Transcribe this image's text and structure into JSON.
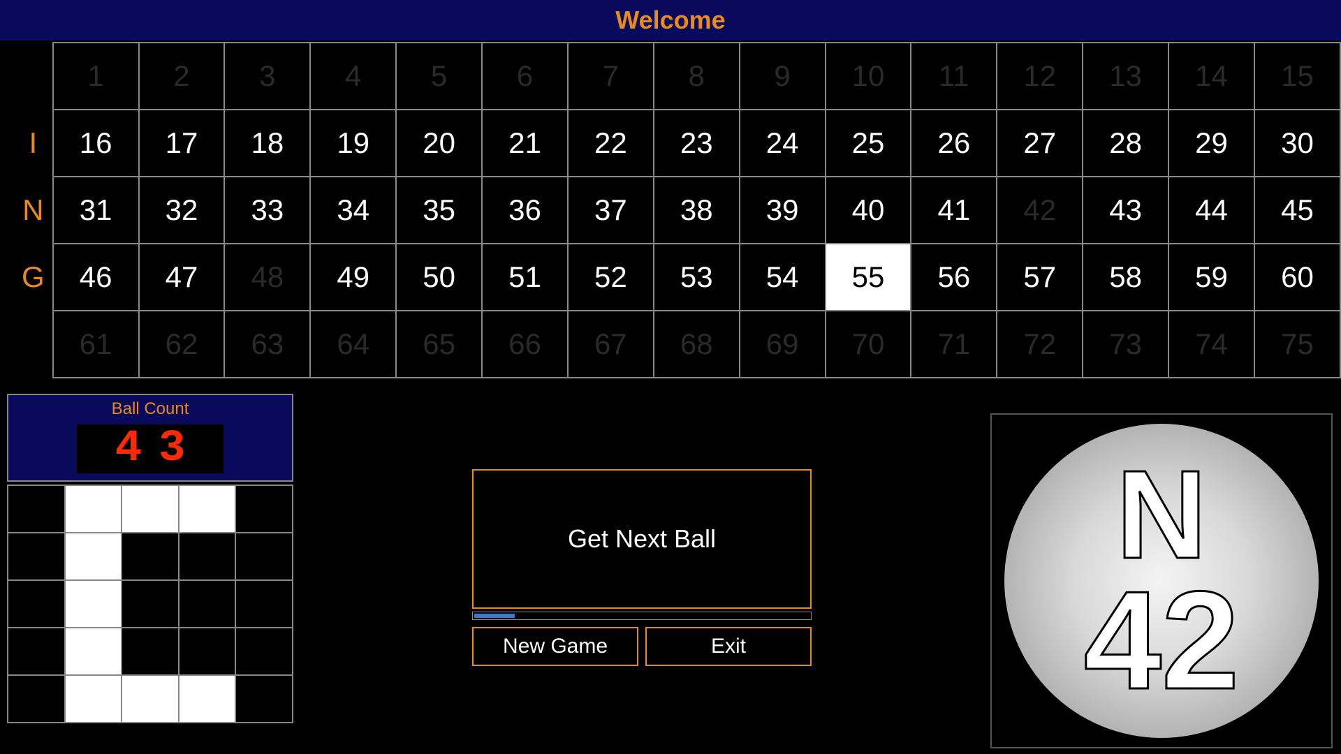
{
  "header": {
    "title": "Welcome"
  },
  "row_labels": [
    "",
    "I",
    "N",
    "G",
    ""
  ],
  "board": {
    "rows": [
      [
        {
          "n": 1,
          "s": "dim"
        },
        {
          "n": 2,
          "s": "dim"
        },
        {
          "n": 3,
          "s": "dim"
        },
        {
          "n": 4,
          "s": "dim"
        },
        {
          "n": 5,
          "s": "dim"
        },
        {
          "n": 6,
          "s": "dim"
        },
        {
          "n": 7,
          "s": "dim"
        },
        {
          "n": 8,
          "s": "dim"
        },
        {
          "n": 9,
          "s": "dim"
        },
        {
          "n": 10,
          "s": "dim"
        },
        {
          "n": 11,
          "s": "dim"
        },
        {
          "n": 12,
          "s": "dim"
        },
        {
          "n": 13,
          "s": "dim"
        },
        {
          "n": 14,
          "s": "dim"
        },
        {
          "n": 15,
          "s": "dim"
        }
      ],
      [
        {
          "n": 16,
          "s": "on"
        },
        {
          "n": 17,
          "s": "on"
        },
        {
          "n": 18,
          "s": "on"
        },
        {
          "n": 19,
          "s": "on"
        },
        {
          "n": 20,
          "s": "on"
        },
        {
          "n": 21,
          "s": "on"
        },
        {
          "n": 22,
          "s": "on"
        },
        {
          "n": 23,
          "s": "on"
        },
        {
          "n": 24,
          "s": "on"
        },
        {
          "n": 25,
          "s": "on"
        },
        {
          "n": 26,
          "s": "on"
        },
        {
          "n": 27,
          "s": "on"
        },
        {
          "n": 28,
          "s": "on"
        },
        {
          "n": 29,
          "s": "on"
        },
        {
          "n": 30,
          "s": "on"
        }
      ],
      [
        {
          "n": 31,
          "s": "on"
        },
        {
          "n": 32,
          "s": "on"
        },
        {
          "n": 33,
          "s": "on"
        },
        {
          "n": 34,
          "s": "on"
        },
        {
          "n": 35,
          "s": "on"
        },
        {
          "n": 36,
          "s": "on"
        },
        {
          "n": 37,
          "s": "on"
        },
        {
          "n": 38,
          "s": "on"
        },
        {
          "n": 39,
          "s": "on"
        },
        {
          "n": 40,
          "s": "on"
        },
        {
          "n": 41,
          "s": "on"
        },
        {
          "n": 42,
          "s": "dim"
        },
        {
          "n": 43,
          "s": "on"
        },
        {
          "n": 44,
          "s": "on"
        },
        {
          "n": 45,
          "s": "on"
        }
      ],
      [
        {
          "n": 46,
          "s": "on"
        },
        {
          "n": 47,
          "s": "on"
        },
        {
          "n": 48,
          "s": "dim"
        },
        {
          "n": 49,
          "s": "on"
        },
        {
          "n": 50,
          "s": "on"
        },
        {
          "n": 51,
          "s": "on"
        },
        {
          "n": 52,
          "s": "on"
        },
        {
          "n": 53,
          "s": "on"
        },
        {
          "n": 54,
          "s": "on"
        },
        {
          "n": 55,
          "s": "last"
        },
        {
          "n": 56,
          "s": "on"
        },
        {
          "n": 57,
          "s": "on"
        },
        {
          "n": 58,
          "s": "on"
        },
        {
          "n": 59,
          "s": "on"
        },
        {
          "n": 60,
          "s": "on"
        }
      ],
      [
        {
          "n": 61,
          "s": "dim"
        },
        {
          "n": 62,
          "s": "dim"
        },
        {
          "n": 63,
          "s": "dim"
        },
        {
          "n": 64,
          "s": "dim"
        },
        {
          "n": 65,
          "s": "dim"
        },
        {
          "n": 66,
          "s": "dim"
        },
        {
          "n": 67,
          "s": "dim"
        },
        {
          "n": 68,
          "s": "dim"
        },
        {
          "n": 69,
          "s": "dim"
        },
        {
          "n": 70,
          "s": "dim"
        },
        {
          "n": 71,
          "s": "dim"
        },
        {
          "n": 72,
          "s": "dim"
        },
        {
          "n": 73,
          "s": "dim"
        },
        {
          "n": 74,
          "s": "dim"
        },
        {
          "n": 75,
          "s": "dim"
        }
      ]
    ]
  },
  "ball_count": {
    "label": "Ball Count",
    "value": "43"
  },
  "pattern": [
    [
      0,
      1,
      1,
      1,
      0
    ],
    [
      0,
      1,
      0,
      0,
      0
    ],
    [
      0,
      1,
      0,
      0,
      0
    ],
    [
      0,
      1,
      0,
      0,
      0
    ],
    [
      0,
      1,
      1,
      1,
      0
    ]
  ],
  "buttons": {
    "get_next": "Get Next Ball",
    "new_game": "New Game",
    "exit": "Exit"
  },
  "progress_pct": 12,
  "current_ball": {
    "letter": "N",
    "number": "42"
  }
}
